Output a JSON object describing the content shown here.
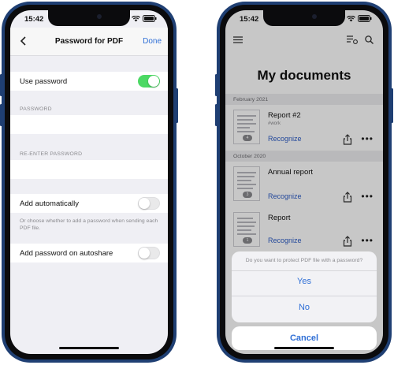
{
  "left": {
    "status_time": "15:42",
    "nav": {
      "back_icon": "chevron-left-icon",
      "title": "Password for PDF",
      "done": "Done"
    },
    "use_password": {
      "label": "Use password",
      "on": true
    },
    "password_header": "PASSWORD",
    "password_value": "",
    "reenter_header": "RE-ENTER PASSWORD",
    "reenter_value": "",
    "add_auto": {
      "label": "Add automatically",
      "on": false
    },
    "add_auto_note": "Or choose whether to add a password when sending each PDF file.",
    "autoshare": {
      "label": "Add password on autoshare",
      "on": false
    }
  },
  "right": {
    "status_time": "15:42",
    "title": "My documents",
    "groups": [
      "February 2021",
      "October 2020"
    ],
    "docs": [
      {
        "name": "Report #2",
        "tag": "#work",
        "pages": "4",
        "action": "Recognize"
      },
      {
        "name": "Annual report",
        "tag": "",
        "pages": "3",
        "action": "Recognize"
      },
      {
        "name": "Report",
        "tag": "",
        "pages": "1",
        "action": "Recognize"
      }
    ],
    "sheet": {
      "question": "Do you want to protect PDF file with a password?",
      "yes": "Yes",
      "no": "No",
      "cancel": "Cancel"
    }
  },
  "colors": {
    "accent": "#2f6fd6",
    "toggle_on": "#4cd964",
    "phone_frame": "#1f3f73"
  }
}
